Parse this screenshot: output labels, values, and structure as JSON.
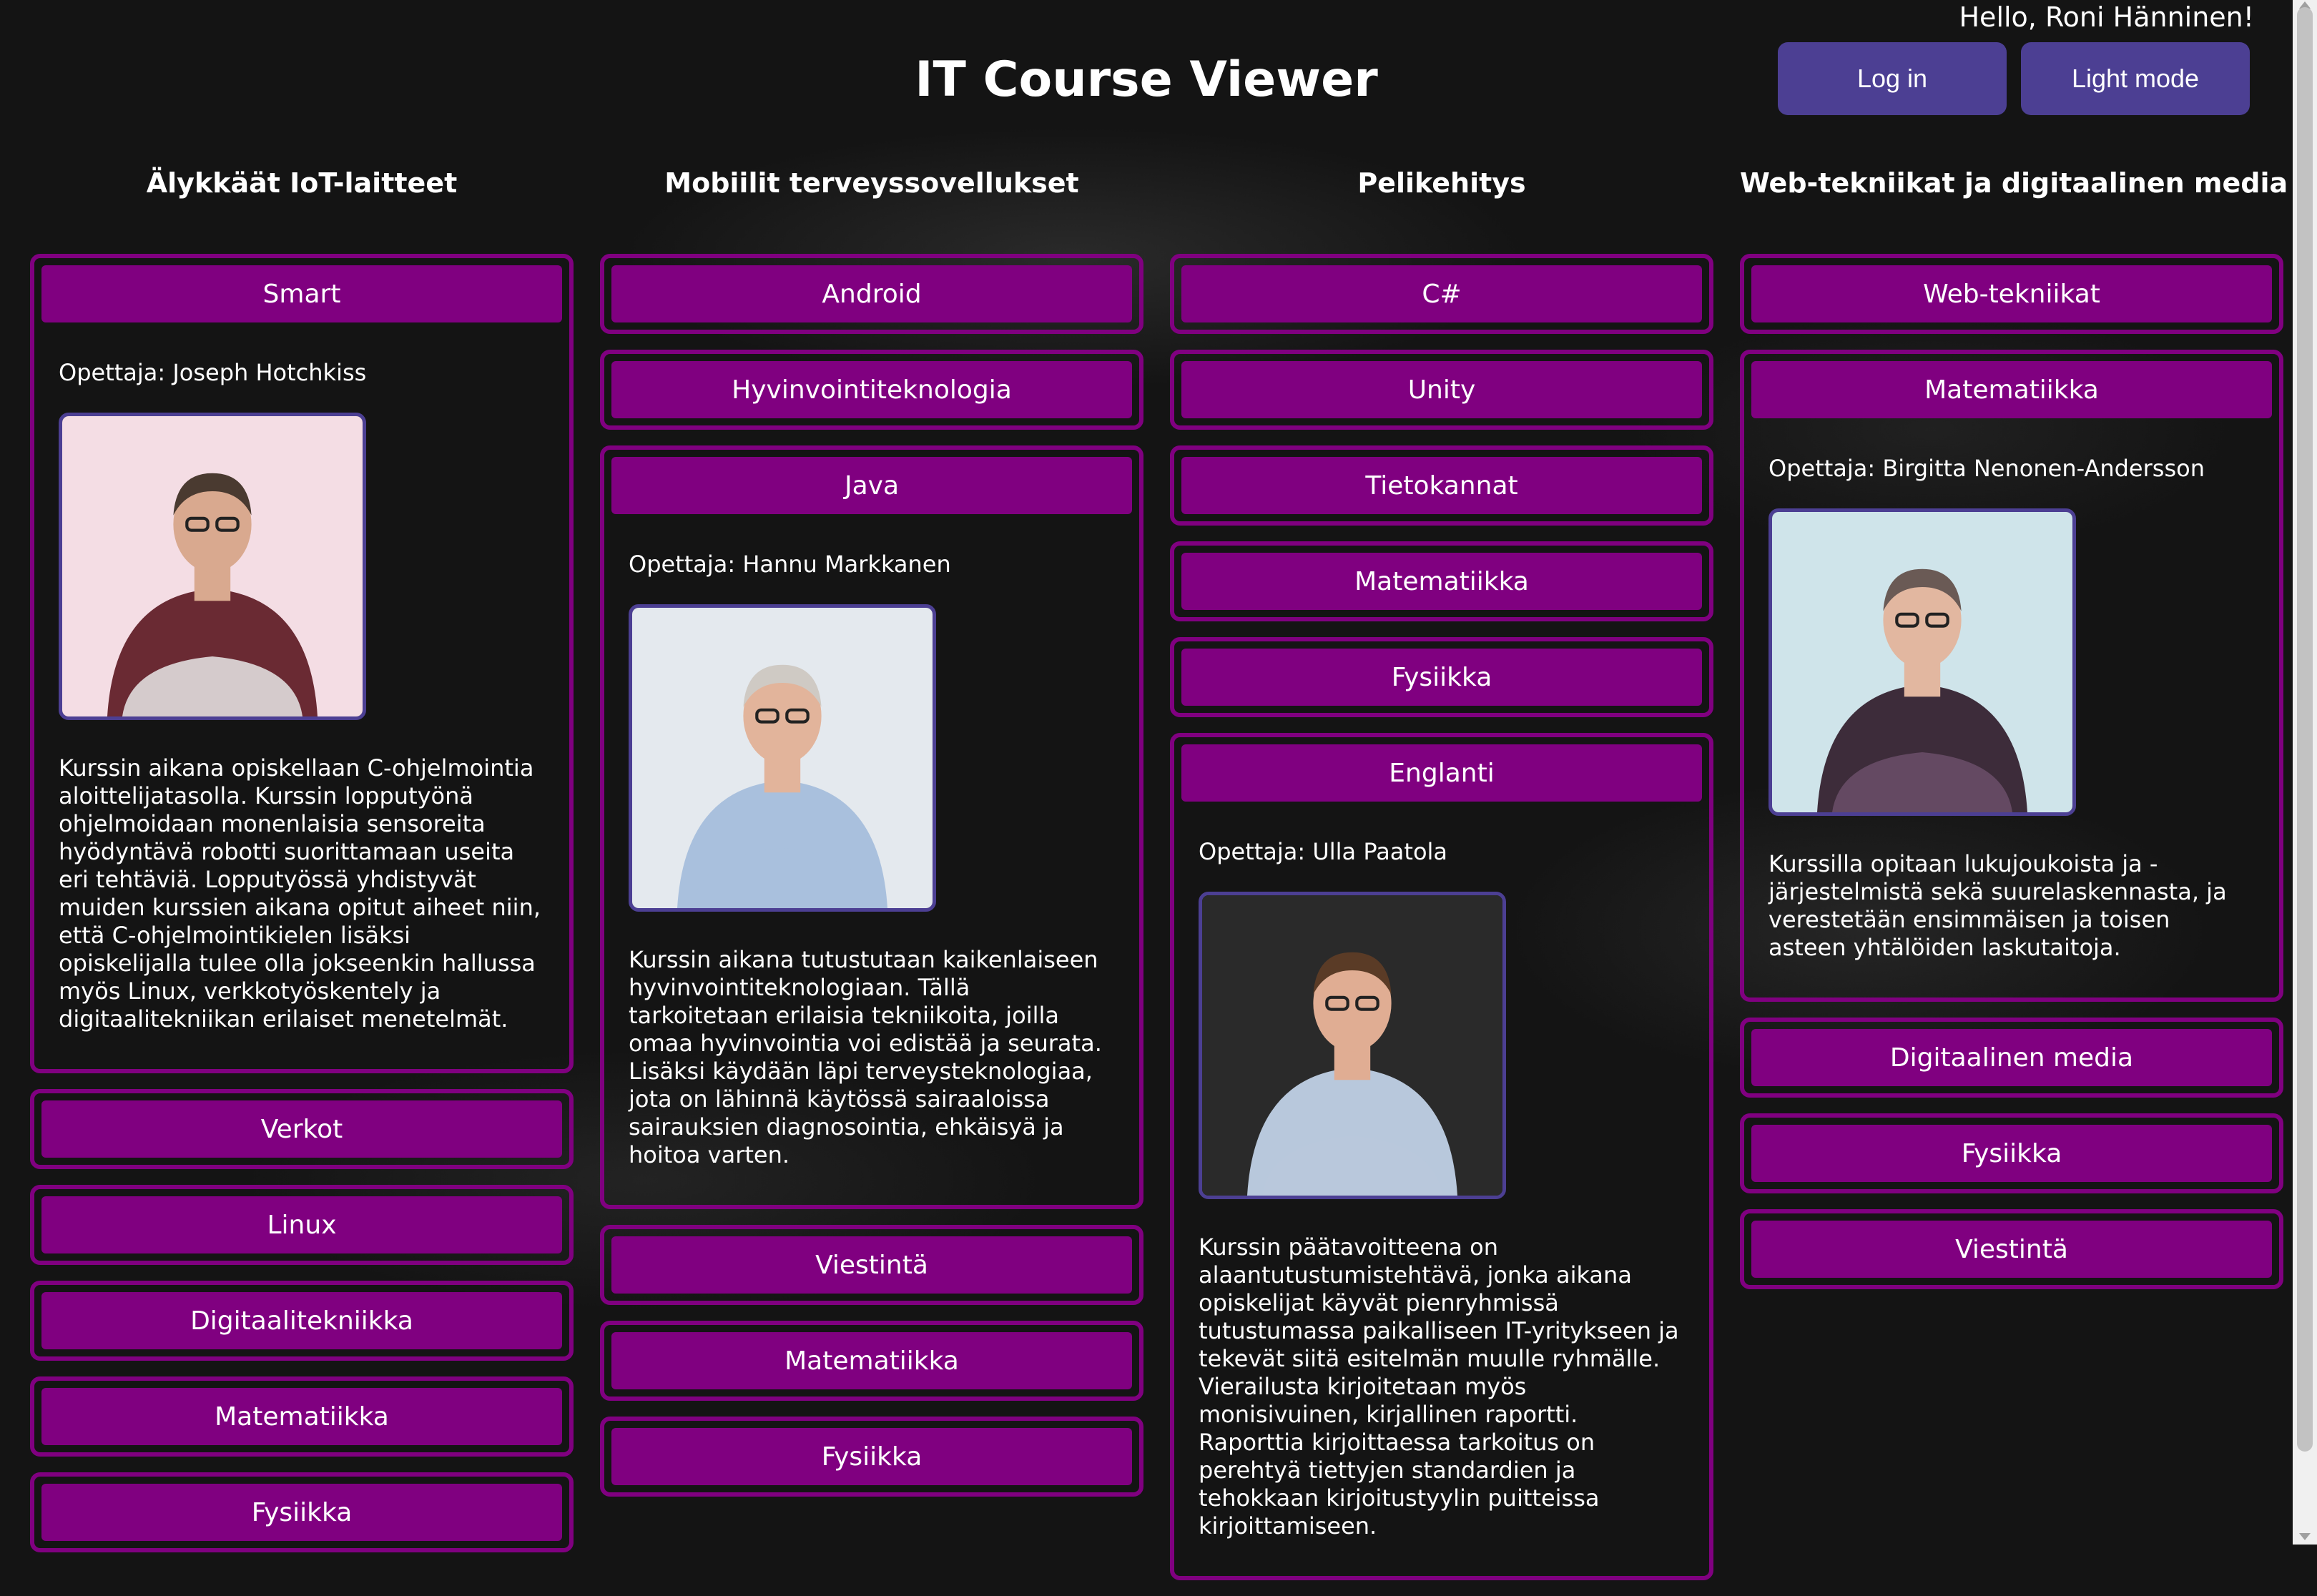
{
  "header": {
    "greeting": "Hello, Roni Hänninen!",
    "title": "IT Course Viewer",
    "login_label": "Log in",
    "theme_label": "Light mode"
  },
  "colors": {
    "accent": "#800080",
    "button": "#4c3f93",
    "background": "#141414"
  },
  "columns": [
    {
      "title": "Älykkäät IoT-laitteet",
      "courses": [
        {
          "name": "Smart",
          "teacher": "Opettaja: Joseph Hotchkiss",
          "photo": "teacher-photo-joseph-hotchkiss",
          "description": "Kurssin aikana opiskellaan C-ohjelmointia aloittelijatasolla. Kurssin lopputyönä ohjelmoidaan monenlaisia sensoreita hyödyntävä robotti suorittamaan useita eri tehtäviä. Lopputyössä yhdistyvät muiden kurssien aikana opitut aiheet niin, että C-ohjelmointikielen lisäksi opiskelijalla tulee olla jokseenkin hallussa myös Linux, verkkotyöskentely ja digitaalitekniikan erilaiset menetelmät."
        },
        {
          "name": "Verkot"
        },
        {
          "name": "Linux"
        },
        {
          "name": "Digitaalitekniikka"
        },
        {
          "name": "Matematiikka"
        },
        {
          "name": "Fysiikka"
        }
      ]
    },
    {
      "title": "Mobiilit terveyssovellukset",
      "courses": [
        {
          "name": "Android"
        },
        {
          "name": "Hyvinvointiteknologia"
        },
        {
          "name": "Java",
          "teacher": "Opettaja: Hannu Markkanen",
          "photo": "teacher-photo-hannu-markkanen",
          "description": "Kurssin aikana tutustutaan kaikenlaiseen hyvinvointiteknologiaan. Tällä tarkoitetaan erilaisia tekniikoita, joilla omaa hyvinvointia voi edistää ja seurata. Lisäksi käydään läpi terveysteknologiaa, jota on lähinnä käytössä sairaaloissa sairauksien diagnosointia, ehkäisyä ja hoitoa varten."
        },
        {
          "name": "Viestintä"
        },
        {
          "name": "Matematiikka"
        },
        {
          "name": "Fysiikka"
        }
      ]
    },
    {
      "title": "Pelikehitys",
      "courses": [
        {
          "name": "C#"
        },
        {
          "name": "Unity"
        },
        {
          "name": "Tietokannat"
        },
        {
          "name": "Matematiikka"
        },
        {
          "name": "Fysiikka"
        },
        {
          "name": "Englanti",
          "teacher": "Opettaja: Ulla Paatola",
          "photo": "teacher-photo-ulla-paatola",
          "description": "Kurssin päätavoitteena on alaantutustumistehtävä, jonka aikana opiskelijat käyvät pienryhmissä tutustumassa paikalliseen IT-yritykseen ja tekevät siitä esitelmän muulle ryhmälle. Vierailusta kirjoitetaan myös monisivuinen, kirjallinen raportti. Raporttia kirjoittaessa tarkoitus on perehtyä tiettyjen standardien ja tehokkaan kirjoitustyylin puitteissa kirjoittamiseen."
        }
      ]
    },
    {
      "title": "Web-tekniikat ja digitaalinen media",
      "courses": [
        {
          "name": "Web-tekniikat"
        },
        {
          "name": "Matematiikka",
          "teacher": "Opettaja: Birgitta Nenonen-Andersson",
          "photo": "teacher-photo-birgitta-nenonen-andersson",
          "description": "Kurssilla opitaan lukujoukoista ja -järjestelmistä sekä suurelaskennasta, ja verestetään ensimmäisen ja toisen asteen yhtälöiden laskutaitoja."
        },
        {
          "name": "Digitaalinen media"
        },
        {
          "name": "Fysiikka"
        },
        {
          "name": "Viestintä"
        }
      ]
    }
  ]
}
